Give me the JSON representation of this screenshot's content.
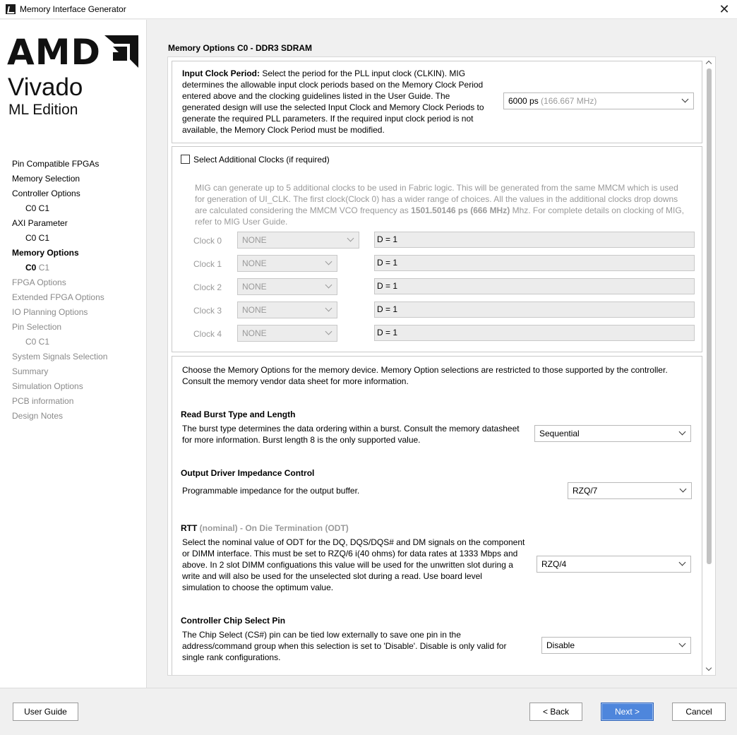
{
  "window": {
    "title": "Memory Interface Generator",
    "close_glyph": "✕"
  },
  "logo": {
    "brand": "AMD",
    "product": "Vivado",
    "edition": "ML Edition"
  },
  "nav": {
    "items": [
      {
        "label": "Pin Compatible FPGAs"
      },
      {
        "label": "Memory Selection"
      },
      {
        "label": "Controller Options"
      },
      {
        "label": "C0 C1"
      },
      {
        "label": "AXI Parameter"
      },
      {
        "label": "C0 C1"
      },
      {
        "label": "Memory Options"
      },
      {
        "current": "C0",
        "rest": "C1"
      },
      {
        "label": "FPGA Options"
      },
      {
        "label": "Extended FPGA Options"
      },
      {
        "label": "IO Planning Options"
      },
      {
        "label": "Pin Selection"
      },
      {
        "label": "C0 C1"
      },
      {
        "label": "System Signals Selection"
      },
      {
        "label": "Summary"
      },
      {
        "label": "Simulation Options"
      },
      {
        "label": "PCB information"
      },
      {
        "label": "Design Notes"
      }
    ]
  },
  "page": {
    "title": "Memory Options C0 - DDR3 SDRAM"
  },
  "input_clock": {
    "heading": "Input Clock Period:",
    "lines": [
      " Select the period for the PLL input clock (CLKIN). MIG",
      "determines the allowable input clock periods based on the Memory Clock Period",
      "entered above and the clocking guidelines listed in the User Guide. The",
      "generated design will use the selected Input Clock and Memory Clock Periods to",
      "generate the required PLL parameters. If the required input clock period is not",
      "available, the Memory Clock Period must be modified."
    ],
    "value": "6000 ps",
    "value_detail": "(166.667 MHz)"
  },
  "additional_clocks": {
    "checkbox_label": "Select Additional Clocks (if required)",
    "desc_lines": [
      "MIG can generate up to 5 additional clocks to be used in Fabric logic. This will be generated from the same MMCM which is used",
      "for generation of UI_CLK. The first clock(Clock 0) has a wider range of choices. All the values in the additional clocks drop downs"
    ],
    "desc_line3_pre": "are calculated considering the MMCM VCO frequency as ",
    "desc_line3_bold": "1501.50146 ps (666 MHz)",
    "desc_line3_post": " Mhz. For complete details on clocking of MIG,",
    "desc_line4": "refer to MIG User Guide.",
    "clocks": [
      {
        "label": "Clock 0",
        "value": "NONE",
        "divider": "D = 1"
      },
      {
        "label": "Clock 1",
        "value": "NONE",
        "divider": "D = 1"
      },
      {
        "label": "Clock 2",
        "value": "NONE",
        "divider": "D = 1"
      },
      {
        "label": "Clock 3",
        "value": "NONE",
        "divider": "D = 1"
      },
      {
        "label": "Clock 4",
        "value": "NONE",
        "divider": "D = 1"
      }
    ]
  },
  "memory_options": {
    "intro_lines": [
      "Choose the Memory Options for the memory device. Memory Option selections are restricted to those supported by the controller.",
      "Consult the memory vendor data sheet for more information."
    ],
    "burst": {
      "heading": "Read Burst Type and Length",
      "lines": [
        "The burst type determines the data ordering within a burst. Consult the memory datasheet",
        "for more information. Burst length 8 is the only supported value."
      ],
      "value": "Sequential"
    },
    "odi": {
      "heading": "Output Driver Impedance Control",
      "line": "Programmable impedance for the output buffer.",
      "value": "RZQ/7"
    },
    "rtt": {
      "heading": "RTT",
      "heading_gray": "(nominal) - On Die Termination (ODT)",
      "lines": [
        "Select the nominal value of ODT for the DQ, DQS/DQS# and DM signals on the component",
        "or DIMM interface. This must be set to RZQ/6 i(40 ohms) for data rates at 1333 Mbps and",
        "above. In 2 slot DIMM configuations this value will be used for the unwritten slot during a",
        "write and will also be used for the unselected slot during a read. Use board level",
        "simulation to choose the optimum value."
      ],
      "value": "RZQ/4"
    },
    "chip_select": {
      "heading": "Controller Chip Select Pin",
      "lines": [
        "The Chip Select (CS#) pin can be tied low externally to save one pin in the",
        "address/command group when this selection is set to 'Disable'. Disable is only valid for",
        "single rank configurations."
      ],
      "value": "Disable"
    }
  },
  "footer": {
    "user_guide": "User Guide",
    "back": "< Back",
    "next": "Next >",
    "cancel": "Cancel"
  },
  "colors": {
    "primary_button": "#4e86dc",
    "disabled_text": "#9a9a9a"
  }
}
